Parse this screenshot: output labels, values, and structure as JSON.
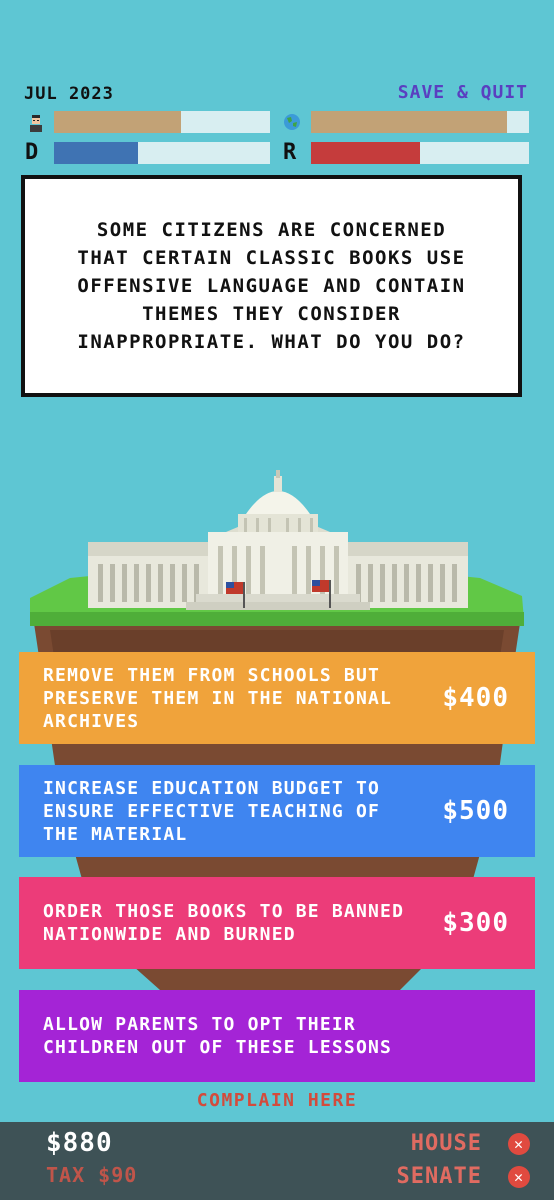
{
  "header": {
    "date": "JUL 2023",
    "save_quit": "SAVE & QUIT"
  },
  "meters": {
    "approval": {
      "icon": "person-icon",
      "fill": 0.59,
      "color": "#c2a276"
    },
    "environment": {
      "icon": "globe-icon",
      "fill": 0.9,
      "color": "#c2a276"
    },
    "democrat": {
      "letter": "D",
      "fill": 0.39,
      "color": "#3f73b3"
    },
    "republican": {
      "letter": "R",
      "fill": 0.5,
      "color": "#c53c3c"
    }
  },
  "question": {
    "text": "SOME CITIZENS ARE CONCERNED THAT CERTAIN CLASSIC BOOKS USE OFFENSIVE LANGUAGE AND CONTAIN THEMES THEY CONSIDER INAPPROPRIATE. WHAT DO YOU DO?"
  },
  "options": [
    {
      "text": "REMOVE THEM FROM SCHOOLS BUT PRESERVE THEM IN THE NATIONAL ARCHIVES",
      "cost": "$400",
      "color": "#f0a33b"
    },
    {
      "text": "INCREASE EDUCATION BUDGET TO ENSURE EFFECTIVE TEACHING OF THE MATERIAL",
      "cost": "$500",
      "color": "#3f85f0"
    },
    {
      "text": "ORDER THOSE BOOKS TO BE BANNED NATIONWIDE AND BURNED",
      "cost": "$300",
      "color": "#ec3c79"
    },
    {
      "text": "ALLOW PARENTS TO OPT THEIR CHILDREN OUT OF THESE LESSONS",
      "cost": "",
      "color": "#a424d6"
    }
  ],
  "complain": "COMPLAIN HERE",
  "footer": {
    "money": "$880",
    "tax": "TAX $90",
    "house": "HOUSE",
    "senate": "SENATE",
    "close_glyph": "✕"
  }
}
